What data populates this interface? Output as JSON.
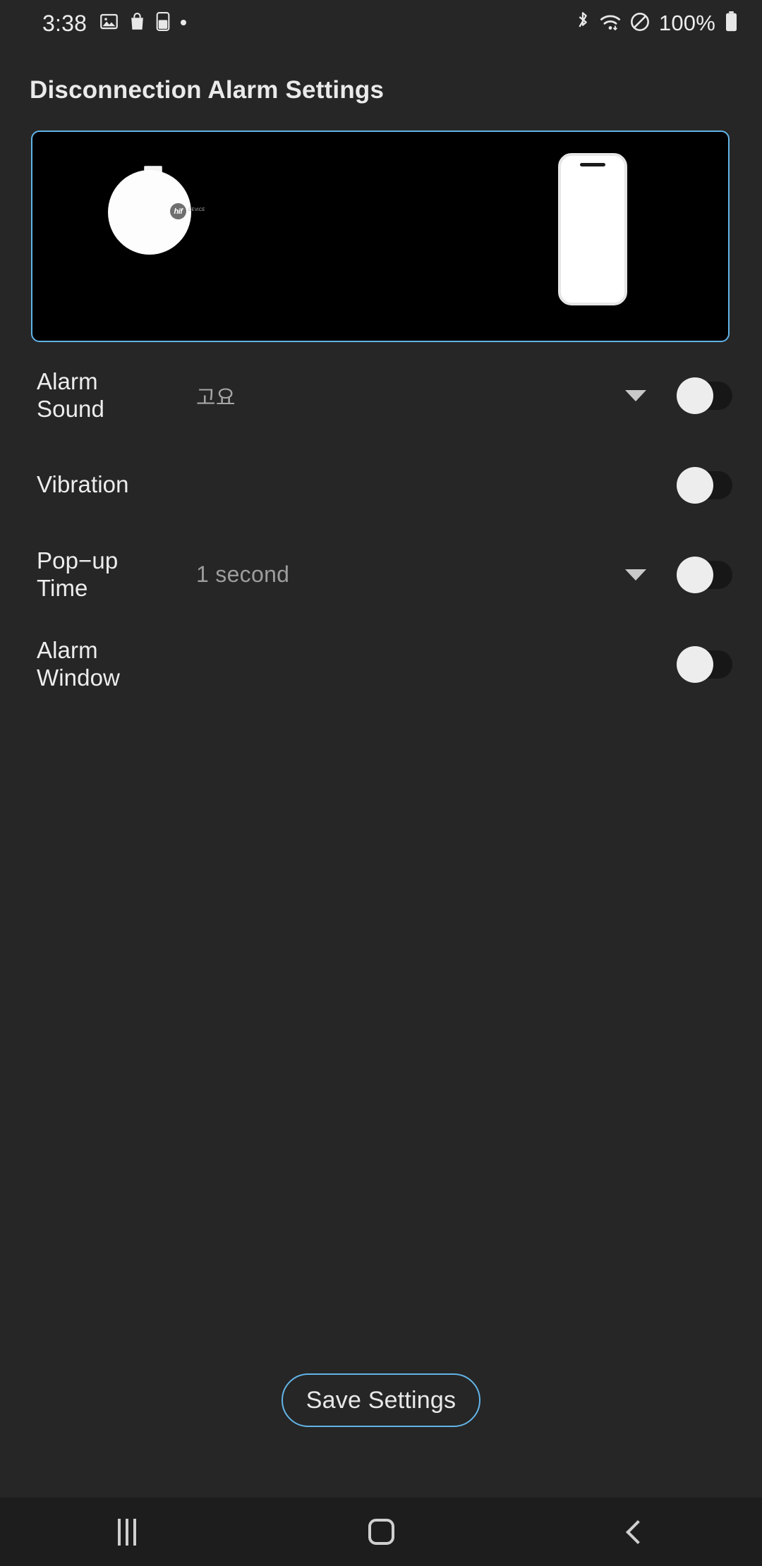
{
  "status_bar": {
    "time": "3:38",
    "battery_percent": "100%",
    "left_icons": [
      "image-icon",
      "shopping-bag-icon",
      "battery-app-icon",
      "dot-icon"
    ],
    "right_icons": [
      "bluetooth-icon",
      "wifi-icon",
      "do-not-disturb-icon",
      "battery-icon"
    ]
  },
  "header": {
    "title": "Disconnection Alarm Settings"
  },
  "hero": {
    "device_logo_text": "hif",
    "device_logo_caption": "DEVICE",
    "accent_color": "#62b4e8",
    "panel_background": "#000000"
  },
  "settings": {
    "rows": [
      {
        "label": "Alarm\nSound",
        "label_line1": "Alarm",
        "label_line2": "Sound",
        "value": "고요",
        "has_dropdown": true,
        "toggle_on": false
      },
      {
        "label": "Vibration",
        "label_line1": "Vibration",
        "label_line2": "",
        "value": "",
        "has_dropdown": false,
        "toggle_on": false
      },
      {
        "label": "Pop−up Time",
        "label_line1": "Pop−up",
        "label_line2": "Time",
        "value": "1 second",
        "has_dropdown": true,
        "toggle_on": false
      },
      {
        "label": "Alarm Window",
        "label_line1": "Alarm Window",
        "label_line2": "",
        "value": "",
        "has_dropdown": false,
        "toggle_on": false
      }
    ]
  },
  "footer": {
    "save_label": "Save Settings"
  },
  "nav_bar": {
    "recents_label": "recents-icon",
    "home_label": "home-icon",
    "back_label": "back-icon"
  }
}
